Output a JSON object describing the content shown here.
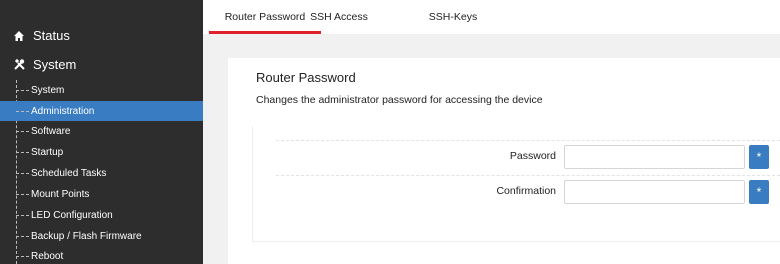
{
  "sidebar": {
    "status_label": "Status",
    "system_label": "System",
    "items": [
      {
        "label": "System"
      },
      {
        "label": "Administration"
      },
      {
        "label": "Software"
      },
      {
        "label": "Startup"
      },
      {
        "label": "Scheduled Tasks"
      },
      {
        "label": "Mount Points"
      },
      {
        "label": "LED Configuration"
      },
      {
        "label": "Backup / Flash Firmware"
      },
      {
        "label": "Reboot"
      }
    ],
    "active_item": "Administration"
  },
  "tabs": [
    {
      "label": "Router Password"
    },
    {
      "label": "SSH Access"
    },
    {
      "label": "SSH-Keys"
    }
  ],
  "active_tab": "Router Password",
  "section": {
    "title": "Router Password",
    "description": "Changes the administrator password for accessing the device"
  },
  "fields": [
    {
      "label": "Password",
      "value": "",
      "reveal_symbol": "*"
    },
    {
      "label": "Confirmation",
      "value": "",
      "reveal_symbol": "*"
    }
  ],
  "colors": {
    "sidebar_bg": "#2d2d2d",
    "accent": "#3a7cc1",
    "tab_underline": "#e0202a"
  }
}
